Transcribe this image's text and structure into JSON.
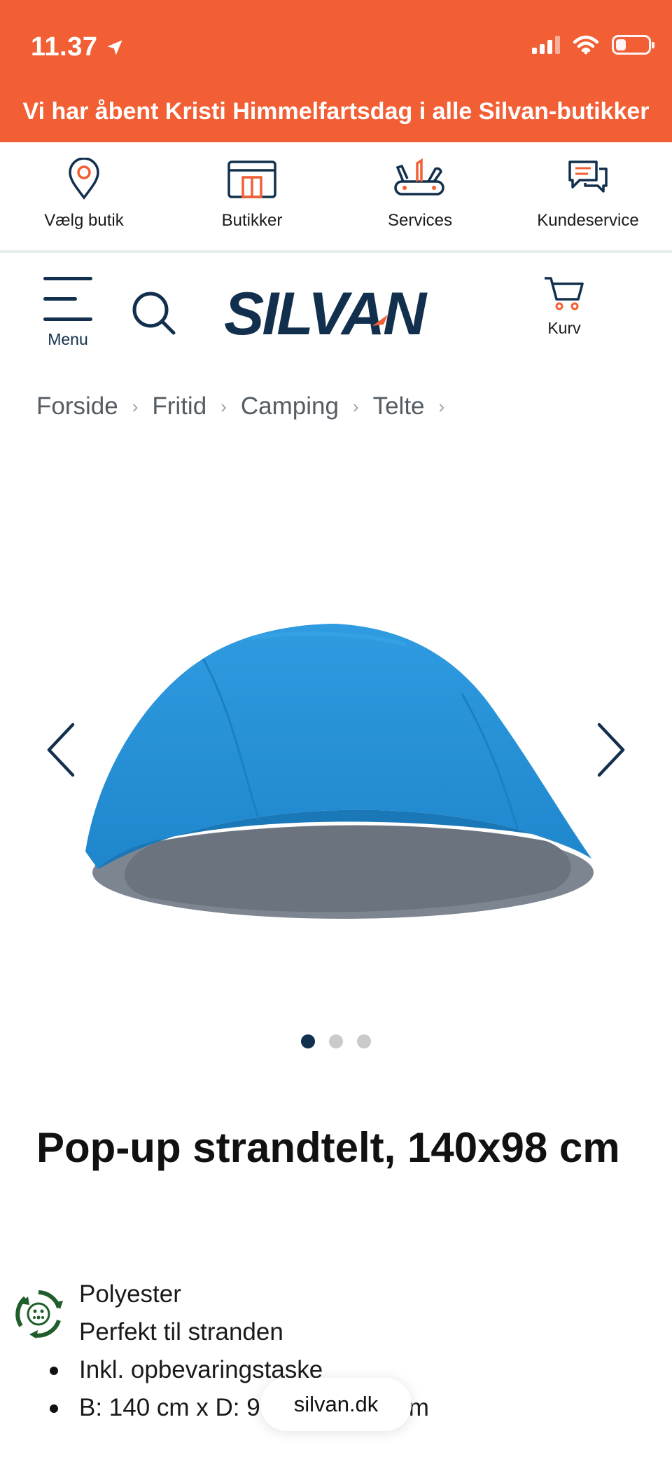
{
  "status_bar": {
    "time": "11.37"
  },
  "promo_banner": "Vi har åbent Kristi Himmelfartsdag i alle Silvan-butikker",
  "utility_nav": [
    {
      "label": "Vælg butik",
      "icon": "location-pin-icon"
    },
    {
      "label": "Butikker",
      "icon": "store-icon"
    },
    {
      "label": "Services",
      "icon": "tools-icon"
    },
    {
      "label": "Kundeservice",
      "icon": "chat-icon"
    }
  ],
  "header": {
    "menu_label": "Menu",
    "logo_text": "SILVAN",
    "cart_label": "Kurv"
  },
  "breadcrumb": [
    "Forside",
    "Fritid",
    "Camping",
    "Telte"
  ],
  "gallery": {
    "image_count": 3,
    "active_index": 0
  },
  "product": {
    "title": "Pop-up strandtelt, 140x98 cm",
    "features": [
      "Polyester",
      "Perfekt til stranden"
    ],
    "bullets": [
      "Inkl. opbevaringstaske",
      "B: 140 cm x D: 9"
    ],
    "bullet_tail": "m"
  },
  "url_bar": {
    "domain": "silvan.dk"
  },
  "colors": {
    "brand_orange": "#f25f35",
    "brand_navy": "#12304d",
    "accent_green": "#1f5e2a"
  }
}
